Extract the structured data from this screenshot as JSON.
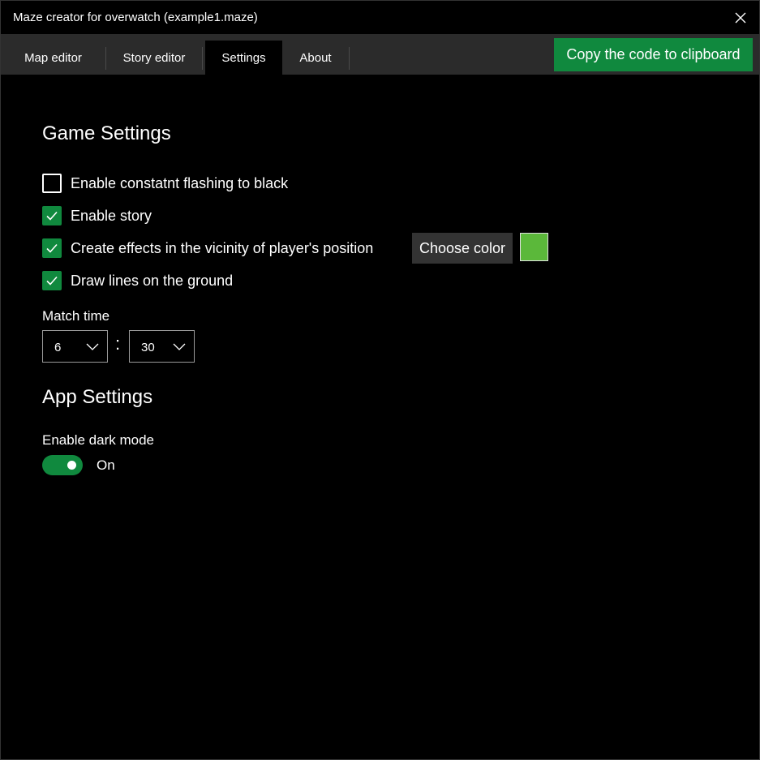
{
  "window": {
    "title": "Maze creator for overwatch (example1.maze)"
  },
  "tabs": [
    {
      "label": "Map editor",
      "selected": false
    },
    {
      "label": "Story editor",
      "selected": false
    },
    {
      "label": "Settings",
      "selected": true
    },
    {
      "label": "About",
      "selected": false
    }
  ],
  "toolbar": {
    "copy_label": "Copy the code to clipboard"
  },
  "game_settings": {
    "heading": "Game Settings",
    "checkboxes": [
      {
        "label": "Enable constatnt flashing to black",
        "checked": false
      },
      {
        "label": "Enable story",
        "checked": true
      },
      {
        "label": "Create effects in the vicinity of player's position",
        "checked": true
      },
      {
        "label": "Draw lines on the ground",
        "checked": true
      }
    ],
    "choose_color_label": "Choose color",
    "effect_color": "#5bb83a",
    "match_time": {
      "label": "Match time",
      "minutes": "6",
      "separator": ":",
      "seconds": "30"
    }
  },
  "app_settings": {
    "heading": "App Settings",
    "dark_mode_label": "Enable dark mode",
    "dark_mode_state": "On",
    "dark_mode_on": true
  },
  "colors": {
    "accent": "#10893e",
    "tab_bar": "#2b2b2b",
    "background": "#000000"
  },
  "icons": {
    "close": "close-icon",
    "check": "checkmark-icon",
    "dropdown": "chevron-down-icon"
  }
}
